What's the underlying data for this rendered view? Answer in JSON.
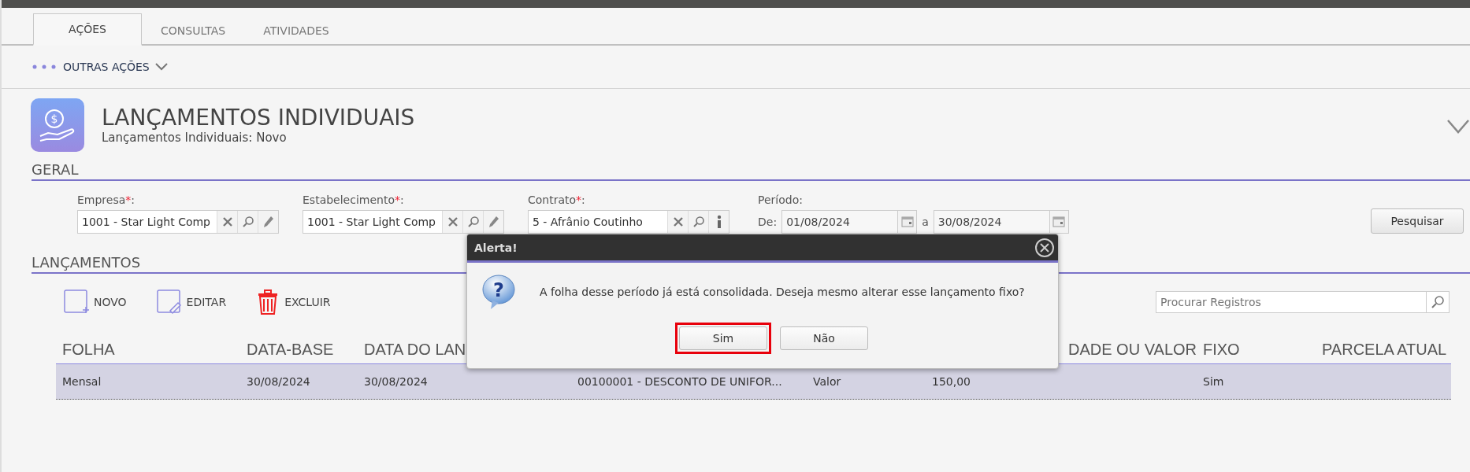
{
  "tabs": [
    {
      "label": "AÇÕES",
      "selected": true
    },
    {
      "label": "CONSULTAS",
      "selected": false
    },
    {
      "label": "ATIVIDADES",
      "selected": false
    }
  ],
  "other_actions": {
    "label": "OUTRAS AÇÕES"
  },
  "page_header": {
    "icon_glyph": "$",
    "title": "LANÇAMENTOS INDIVIDUAIS",
    "subtitle": "Lançamentos Individuais: Novo"
  },
  "general": {
    "title": "GERAL",
    "fields": [
      {
        "label": "Empresa",
        "required_mark": "*",
        "label_end": ":",
        "value": "1001 - Star Light Comp",
        "actions": [
          {
            "kind": "clear"
          },
          {
            "kind": "search"
          },
          {
            "kind": "edit"
          }
        ]
      },
      {
        "label": "Estabelecimento",
        "required_mark": "*",
        "label_end": ":",
        "value": "1001 - Star Light Comp",
        "actions": [
          {
            "kind": "clear"
          },
          {
            "kind": "search"
          },
          {
            "kind": "edit"
          }
        ]
      },
      {
        "label": "Contrato",
        "required_mark": "*",
        "label_end": ":",
        "value": "5 - Afrânio Coutinho",
        "actions": [
          {
            "kind": "clear"
          },
          {
            "kind": "search"
          },
          {
            "kind": "info"
          }
        ]
      }
    ],
    "period": {
      "label": "Período:",
      "from_label": "De:",
      "from": "01/08/2024",
      "between": "a",
      "to": "30/08/2024"
    },
    "search_button": "Pesquisar"
  },
  "launches": {
    "title": "LANÇAMENTOS",
    "toolbar": [
      {
        "kind": "new",
        "label": "NOVO"
      },
      {
        "kind": "edit",
        "label": "EDITAR"
      },
      {
        "kind": "delete",
        "label": "EXCLUIR"
      }
    ],
    "search": {
      "placeholder": "Procurar Registros"
    },
    "table": {
      "columns": [
        {
          "heading": "FOLHA"
        },
        {
          "heading": "DATA-BASE"
        },
        {
          "heading": "DATA DO LAN"
        },
        {},
        {},
        {
          "heading": "DADE OU VALOR"
        },
        {
          "heading": "FIXO"
        },
        {
          "heading": "PARCELA ATUAL"
        }
      ],
      "rows": [
        {
          "selected": true,
          "cells": [
            "Mensal",
            "30/08/2024",
            "30/08/2024",
            "00100001 - DESCONTO DE UNIFOR...",
            "Valor",
            "150,00",
            "Sim"
          ]
        }
      ]
    }
  },
  "dialog": {
    "title": "Alerta!",
    "icon_glyph": "?",
    "message": "A folha desse período já está consolidada. Deseja mesmo alterar esse lançamento fixo?",
    "buttons": [
      {
        "label": "Sim",
        "highlighted": true
      },
      {
        "label": "Não",
        "highlighted": false
      }
    ]
  }
}
